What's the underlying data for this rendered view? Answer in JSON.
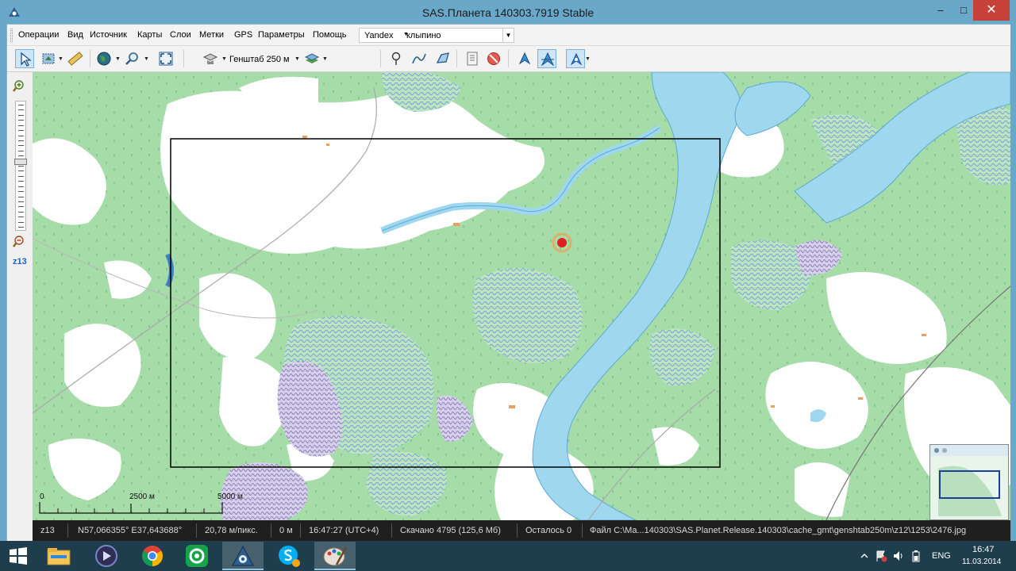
{
  "window": {
    "title": "SAS.Планета 140303.7919 Stable",
    "controls": {
      "minimize": "–",
      "maximize": "□",
      "close": "✕"
    }
  },
  "menu": {
    "items": [
      "Операции",
      "Вид",
      "Источник",
      "Карты",
      "Слои",
      "Метки",
      "GPS",
      "Параметры",
      "Помощь"
    ]
  },
  "search": {
    "provider": "Yandex",
    "value": "клыпино"
  },
  "toolbar": {
    "map_source_label": "Генштаб 250 м",
    "icons": [
      "select-icon",
      "area-select-icon",
      "ruler-icon",
      "globe-icon",
      "zoom-icon",
      "fullscreen-icon",
      "map-type-icon",
      "layers-icon",
      "marker-icon",
      "path-icon",
      "polygon-icon",
      "marks-list-icon",
      "no-marks-icon",
      "gps-icon",
      "gps-track-icon",
      "gps-center-icon"
    ]
  },
  "zoom": {
    "level_label": "z13",
    "level_fraction": 0.47
  },
  "map": {
    "scale_labels": [
      "0",
      "2500 м",
      "5000 м"
    ],
    "colors": {
      "forest": "#a5dca8",
      "open": "#ffffff",
      "water": "#9fd7ef",
      "marsh": "#6ba7cf",
      "selection": "#000000"
    }
  },
  "status": {
    "zoom": "z13",
    "coords": "N57,066355° E37,643688°",
    "resolution": "20,78 м/пикс.",
    "altitude": "0 м",
    "time": "16:47:27 (UTC+4)",
    "downloaded": "Скачано 4795 (125,6 Мб)",
    "remaining": "Осталось 0",
    "file": "Файл C:\\Ma...140303\\SAS.Planet.Release.140303\\cache_gmt\\genshtab250m\\z12\\1253\\2476.jpg"
  },
  "taskbar": {
    "apps": [
      "start-icon",
      "explorer-icon",
      "media-icon",
      "chrome-icon",
      "mail-icon",
      "sas-planet-icon",
      "skype-icon",
      "paint-icon"
    ],
    "language": "ENG",
    "time": "16:47",
    "date": "11.03.2014"
  }
}
